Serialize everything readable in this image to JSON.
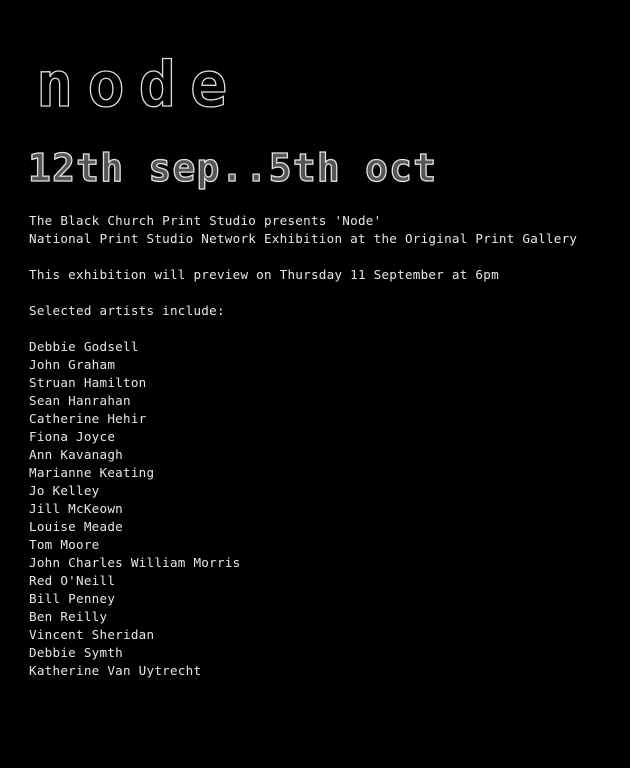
{
  "title": "node",
  "dates": "12th sep..5th oct",
  "intro": {
    "line1": "The Black Church Print Studio presents 'Node'",
    "line2": "National Print Studio Network Exhibition at the Original Print Gallery",
    "preview": "This exhibition will preview on Thursday 11 September at 6pm",
    "artists_heading": "Selected artists include:"
  },
  "artists": [
    "Debbie Godsell",
    "John Graham",
    "Struan Hamilton",
    "Sean Hanrahan",
    "Catherine Hehir",
    "Fiona Joyce",
    "Ann Kavanagh",
    "Marianne Keating",
    "Jo Kelley",
    "Jill McKeown",
    "Louise Meade",
    "Tom Moore",
    "John Charles William Morris",
    "Red O'Neill",
    "Bill Penney",
    "Ben Reilly",
    "Vincent Sheridan",
    "Debbie Symth",
    "Katherine Van Uytrecht"
  ]
}
